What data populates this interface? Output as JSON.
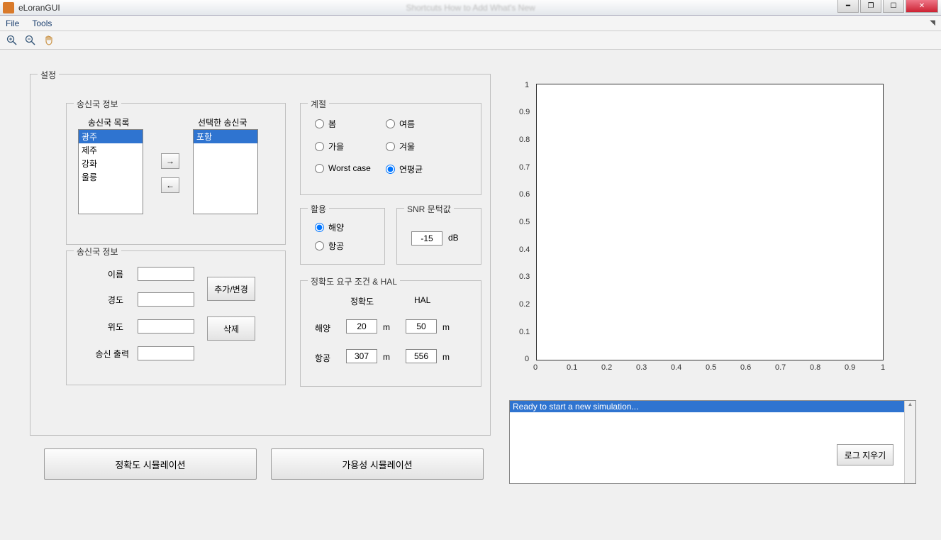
{
  "window": {
    "title": "eLoranGUI",
    "blurred_tabs": "Shortcuts   How to Add   What's New"
  },
  "menu": {
    "file": "File",
    "tools": "Tools"
  },
  "settings": {
    "legend": "설정",
    "station": {
      "legend": "송신국 정보",
      "list_label": "송신국 목록",
      "selected_label": "선택한 송신국",
      "available": [
        "광주",
        "제주",
        "강화",
        "울릉"
      ],
      "selected": [
        "포항"
      ]
    },
    "station_detail": {
      "legend": "송신국 정보",
      "name": "이름",
      "lon": "경도",
      "lat": "위도",
      "power": "송신 출력",
      "add_change": "추가/변경",
      "delete": "삭제"
    },
    "season": {
      "legend": "계절",
      "spring": "봄",
      "summer": "여름",
      "autumn": "가을",
      "winter": "겨울",
      "worst": "Worst case",
      "yearly": "연평균"
    },
    "usage": {
      "legend": "활용",
      "marine": "해양",
      "aviation": "항공"
    },
    "snr": {
      "legend": "SNR 문턱값",
      "value": "-15",
      "unit": "dB"
    },
    "accuracy": {
      "legend": "정확도 요구 조건 & HAL",
      "col_acc": "정확도",
      "col_hal": "HAL",
      "marine_label": "해양",
      "marine_acc": "20",
      "marine_hal": "50",
      "aviation_label": "항공",
      "aviation_acc": "307",
      "aviation_hal": "556",
      "m": "m"
    },
    "btn_acc_sim": "정확도 시뮬레이션",
    "btn_avail_sim": "가용성 시뮬레이션"
  },
  "log": {
    "line": "Ready to start a new simulation...",
    "clear": "로그 지우기"
  },
  "chart_data": {
    "type": "scatter",
    "x": [],
    "y": [],
    "xlim": [
      0,
      1
    ],
    "ylim": [
      0,
      1
    ],
    "xticks": [
      0,
      0.1,
      0.2,
      0.3,
      0.4,
      0.5,
      0.6,
      0.7,
      0.8,
      0.9,
      1
    ],
    "yticks": [
      0,
      0.1,
      0.2,
      0.3,
      0.4,
      0.5,
      0.6,
      0.7,
      0.8,
      0.9,
      1
    ],
    "title": "",
    "xlabel": "",
    "ylabel": ""
  }
}
